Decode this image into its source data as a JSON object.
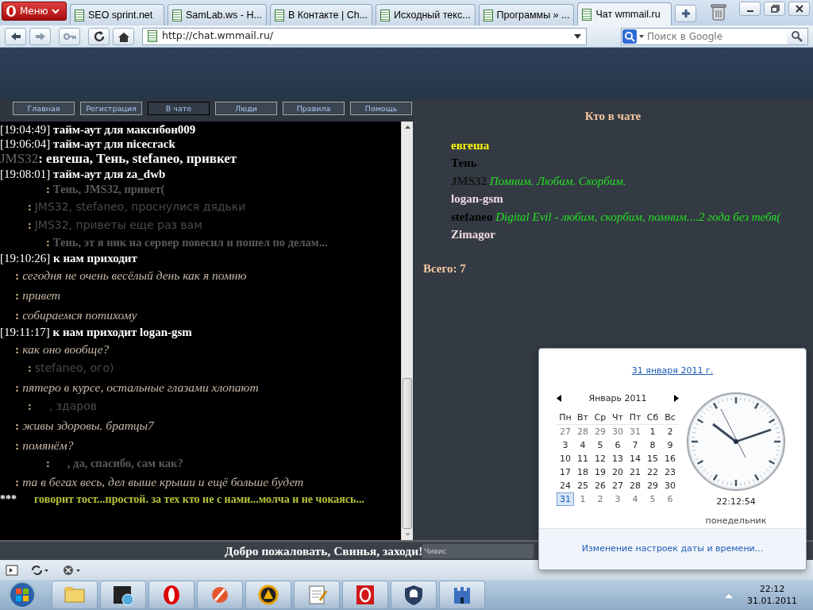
{
  "browser": {
    "menu": "Меню",
    "tabs": [
      {
        "label": "SEO sprint.net",
        "selected": false
      },
      {
        "label": "SamLab.ws - Н...",
        "selected": false
      },
      {
        "label": "В Контакте | Ch...",
        "selected": false
      },
      {
        "label": "Исходный текс...",
        "selected": false
      },
      {
        "label": "Программы » ...",
        "selected": false
      },
      {
        "label": "Чат wmmail.ru",
        "selected": true
      }
    ],
    "address": "http://chat.wmmail.ru/",
    "search": {
      "placeholder": "Поиск в Google"
    }
  },
  "site_nav": [
    {
      "label": "Главная",
      "selected": false
    },
    {
      "label": "Регистрация",
      "selected": false
    },
    {
      "label": "В чате",
      "selected": true
    },
    {
      "label": "Люди",
      "selected": false
    },
    {
      "label": "Правила",
      "selected": false
    },
    {
      "label": "Помощь",
      "selected": false
    }
  ],
  "chat": [
    {
      "kind": "event",
      "time": "[19:04:49]",
      "text": "тайм-аут для максибон009"
    },
    {
      "kind": "event",
      "time": "[19:06:04]",
      "text": "тайм-аут для nicecrack"
    },
    {
      "kind": "nick",
      "nick": "JMS32",
      "text": ": евгеша, Тень, stefaneo, привкет"
    },
    {
      "kind": "event",
      "time": "[19:08:01]",
      "text": "тайм-аут для za_dwb"
    },
    {
      "kind": "bold",
      "sep": ":",
      "text": "Тень, JMS32, привет("
    },
    {
      "kind": "script",
      "sep": ":",
      "text": "JMS32, stefaneo, проснулися дядьки"
    },
    {
      "kind": "script",
      "sep": ":",
      "text": "JMS32, приветы еще раз вам"
    },
    {
      "kind": "bold",
      "sep": ":",
      "text": "Тень, эт я ник на сервер повесил и пошел по делам..."
    },
    {
      "kind": "event",
      "time": "[19:10:26]",
      "text": "к нам приходит"
    },
    {
      "kind": "italic",
      "sep": ":",
      "text": "сегодня не очень весёлый день как я помню"
    },
    {
      "kind": "italic",
      "sep": ":",
      "text": "привет"
    },
    {
      "kind": "italic",
      "sep": ":",
      "text": "собираемся потихому"
    },
    {
      "kind": "event",
      "time": "[19:11:17]",
      "text": "к нам приходит logan-gsm"
    },
    {
      "kind": "italic",
      "sep": ":",
      "text": "как оно вообще?"
    },
    {
      "kind": "script",
      "sep": ":",
      "text": "stefaneo, ого)"
    },
    {
      "kind": "italic",
      "sep": ":",
      "text": "пятеро в курсе, остальные глазами хлопают"
    },
    {
      "kind": "script_gap",
      "sep": ":",
      "text": ", здаров"
    },
    {
      "kind": "italic",
      "sep": ":",
      "text": "живы здоровы. братцы7"
    },
    {
      "kind": "italic",
      "sep": ":",
      "text": "помянём?"
    },
    {
      "kind": "bold_gap",
      "sep": ":",
      "text": ", да, спасибо, сам как?"
    },
    {
      "kind": "italic",
      "sep": ":",
      "text": "та в бегах весь, дел выше крыши и ещё больше будет"
    },
    {
      "kind": "toast",
      "mark": "***",
      "text": "говорит тост...простой. за тех кто не с нами...молча и не чокаясь..."
    }
  ],
  "who": {
    "title": "Кто в чате",
    "users": [
      {
        "name": "евгеша",
        "color": "#ffff00"
      },
      {
        "name": "Тень",
        "color": "#000000"
      },
      {
        "name": "JMS32",
        "color": "#141414",
        "status": "Помним. Любим. Скорбим."
      },
      {
        "name": "logan-gsm",
        "color": "#f2dbe6"
      },
      {
        "name": "stefaneo",
        "color": "#000000",
        "status": "Digital Evil - любим, скорбим, помним....2 года без тебя("
      },
      {
        "name": "Zimagor",
        "color": "#f5dde0"
      }
    ],
    "total": "Всего: 7"
  },
  "welcome": "Добро пожаловать, Свинья, заходи!",
  "message_input": {
    "value": "Чивис"
  },
  "taskbar": {
    "time": "22:12",
    "date": "31.01.2011"
  },
  "calendar": {
    "date": "31 января 2011 г.",
    "month": "Январь 2011",
    "weekdays": [
      "Пн",
      "Вт",
      "Ср",
      "Чт",
      "Пт",
      "Сб",
      "Вс"
    ],
    "days": [
      {
        "d": "27",
        "muted": true,
        "selected": false
      },
      {
        "d": "28",
        "muted": true,
        "selected": false
      },
      {
        "d": "29",
        "muted": true,
        "selected": false
      },
      {
        "d": "30",
        "muted": true,
        "selected": false
      },
      {
        "d": "31",
        "muted": true,
        "selected": false
      },
      {
        "d": "1",
        "muted": false,
        "selected": false
      },
      {
        "d": "2",
        "muted": false,
        "selected": false
      },
      {
        "d": "3",
        "muted": false,
        "selected": false
      },
      {
        "d": "4",
        "muted": false,
        "selected": false
      },
      {
        "d": "5",
        "muted": false,
        "selected": false
      },
      {
        "d": "6",
        "muted": false,
        "selected": false
      },
      {
        "d": "7",
        "muted": false,
        "selected": false
      },
      {
        "d": "8",
        "muted": false,
        "selected": false
      },
      {
        "d": "9",
        "muted": false,
        "selected": false
      },
      {
        "d": "10",
        "muted": false,
        "selected": false
      },
      {
        "d": "11",
        "muted": false,
        "selected": false
      },
      {
        "d": "12",
        "muted": false,
        "selected": false
      },
      {
        "d": "13",
        "muted": false,
        "selected": false
      },
      {
        "d": "14",
        "muted": false,
        "selected": false
      },
      {
        "d": "15",
        "muted": false,
        "selected": false
      },
      {
        "d": "16",
        "muted": false,
        "selected": false
      },
      {
        "d": "17",
        "muted": false,
        "selected": false
      },
      {
        "d": "18",
        "muted": false,
        "selected": false
      },
      {
        "d": "19",
        "muted": false,
        "selected": false
      },
      {
        "d": "20",
        "muted": false,
        "selected": false
      },
      {
        "d": "21",
        "muted": false,
        "selected": false
      },
      {
        "d": "22",
        "muted": false,
        "selected": false
      },
      {
        "d": "23",
        "muted": false,
        "selected": false
      },
      {
        "d": "24",
        "muted": false,
        "selected": false
      },
      {
        "d": "25",
        "muted": false,
        "selected": false
      },
      {
        "d": "26",
        "muted": false,
        "selected": false
      },
      {
        "d": "27",
        "muted": false,
        "selected": false
      },
      {
        "d": "28",
        "muted": false,
        "selected": false
      },
      {
        "d": "29",
        "muted": false,
        "selected": false
      },
      {
        "d": "30",
        "muted": false,
        "selected": false
      },
      {
        "d": "31",
        "muted": false,
        "selected": true
      },
      {
        "d": "1",
        "muted": true,
        "selected": false
      },
      {
        "d": "2",
        "muted": true,
        "selected": false
      },
      {
        "d": "3",
        "muted": true,
        "selected": false
      },
      {
        "d": "4",
        "muted": true,
        "selected": false
      },
      {
        "d": "5",
        "muted": true,
        "selected": false
      },
      {
        "d": "6",
        "muted": true,
        "selected": false
      }
    ],
    "time": "22:12:54",
    "weekday": "понедельник",
    "settings_link": "Изменение настроек даты и времени..."
  }
}
